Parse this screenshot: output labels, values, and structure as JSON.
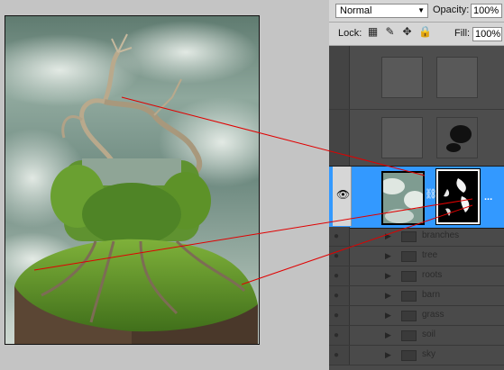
{
  "options_bar": {
    "blend_mode": "Normal",
    "opacity_label": "Opacity:",
    "opacity_value": "100%",
    "lock_label": "Lock:",
    "fill_label": "Fill:",
    "fill_value": "100%"
  },
  "layer_groups": [
    {
      "name": "branches"
    },
    {
      "name": "tree"
    },
    {
      "name": "roots"
    },
    {
      "name": "barn"
    },
    {
      "name": "grass"
    },
    {
      "name": "soil"
    },
    {
      "name": "sky"
    }
  ],
  "icons": {
    "eye": "eye-icon",
    "link": "chain-link-icon",
    "lock": "lock-icon",
    "more": "ellipsis-icon"
  },
  "colors": {
    "selection": "#3399ff",
    "callout_lines": "#e00000",
    "panel_bg": "#4a4a4a"
  }
}
